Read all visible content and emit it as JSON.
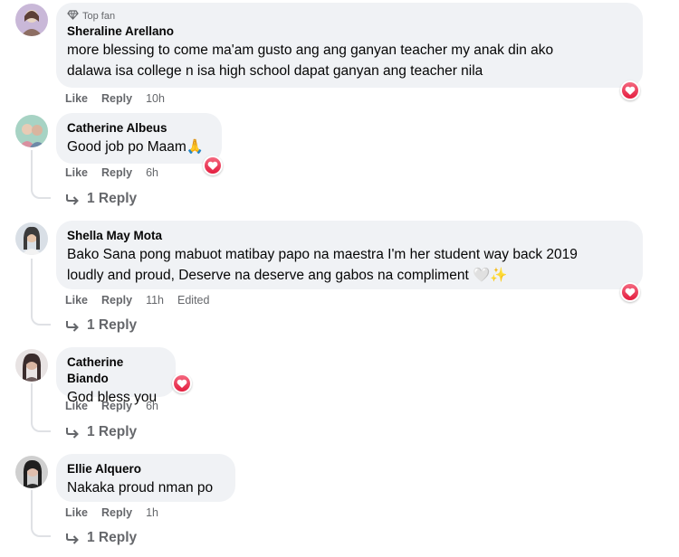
{
  "comments": [
    {
      "badge": "Top fan",
      "author": "Sheraline Arellano",
      "lines": [
        "more blessing to come ma'am gusto ang ang ganyan teacher my anak din ako",
        "dalawa isa college n isa high school dapat ganyan ang teacher nila"
      ],
      "actions": {
        "like": "Like",
        "reply": "Reply",
        "time": "10h",
        "edited": ""
      },
      "avatar_colors": [
        "#c9b8d8",
        "#8d6e63",
        "#e8d6c4"
      ]
    },
    {
      "author": "Catherine Albeus",
      "lines": [
        "Good job po Maam🙏"
      ],
      "actions": {
        "like": "Like",
        "reply": "Reply",
        "time": "6h",
        "edited": ""
      },
      "view_replies": "1 Reply",
      "avatar_colors": [
        "#a7d3c4",
        "#d98f9f",
        "#6d8aa8"
      ]
    },
    {
      "author": "Shella May Mota",
      "lines": [
        "Bako Sana pong mabuot matibay papo na maestra I'm her student way back 2019",
        "loudly and proud, Deserve na deserve ang gabos na compliment 🤍✨"
      ],
      "actions": {
        "like": "Like",
        "reply": "Reply",
        "time": "11h",
        "edited": "Edited"
      },
      "view_replies": "1 Reply",
      "avatar_colors": [
        "#d9dfe6",
        "#3b3b3b",
        "#e5c4aa"
      ]
    },
    {
      "author": "Catherine Biando",
      "lines": [
        "God bless you"
      ],
      "actions": {
        "like": "Like",
        "reply": "Reply",
        "time": "6h",
        "edited": ""
      },
      "view_replies": "1 Reply",
      "avatar_colors": [
        "#e8e3e3",
        "#3a2c2c",
        "#d9b6a3"
      ]
    },
    {
      "author": "Ellie Alquero",
      "lines": [
        "Nakaka proud nman po"
      ],
      "actions": {
        "like": "Like",
        "reply": "Reply",
        "time": "1h",
        "edited": ""
      },
      "view_replies": "1 Reply",
      "avatar_colors": [
        "#cfcfcf",
        "#1f1f1f",
        "#e0bfae"
      ]
    }
  ],
  "colors": {
    "bubble": "#f0f2f5",
    "muted_text": "#65676b",
    "love_reaction": "#e41e3f"
  },
  "icons": {
    "badge": "diamond-icon",
    "reaction": "heart-reaction-icon",
    "reply_arrow": "reply-arrow-icon"
  }
}
